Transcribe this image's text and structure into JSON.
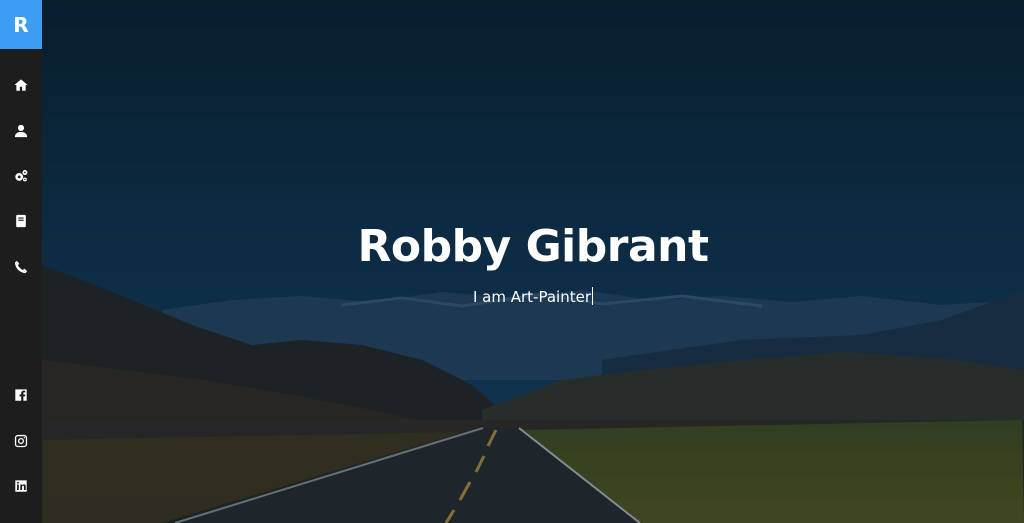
{
  "brand": {
    "logo_letter": "R",
    "logo_color": "#3d9df5"
  },
  "sidebar": {
    "nav": [
      {
        "name": "home",
        "icon": "home-icon"
      },
      {
        "name": "about",
        "icon": "user-icon"
      },
      {
        "name": "services",
        "icon": "gears-icon"
      },
      {
        "name": "portfolio",
        "icon": "book-icon"
      },
      {
        "name": "contact",
        "icon": "phone-icon"
      }
    ],
    "social": [
      {
        "name": "facebook",
        "icon": "facebook-icon"
      },
      {
        "name": "instagram",
        "icon": "instagram-icon"
      },
      {
        "name": "linkedin",
        "icon": "linkedin-icon"
      }
    ]
  },
  "hero": {
    "name": "Robby Gibrant",
    "typed_text": "I am Art-Painter"
  }
}
